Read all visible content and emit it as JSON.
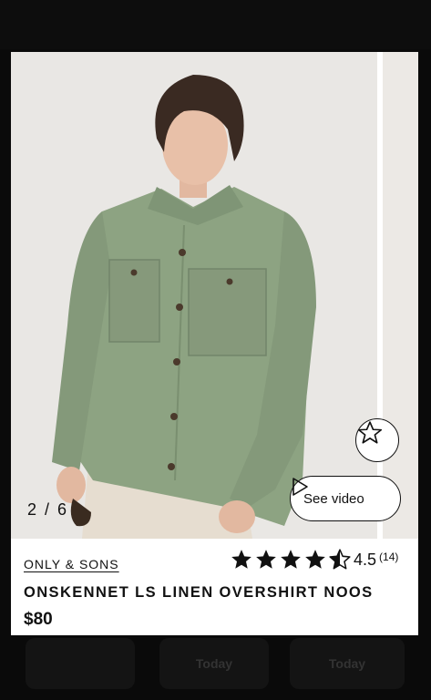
{
  "background": {
    "tiles": [
      "",
      "Today",
      "Today"
    ]
  },
  "gallery": {
    "counter": "2 / 6",
    "see_video_label": "See video"
  },
  "product": {
    "brand": "ONLY & SONS",
    "name": "ONSKENNET LS LINEN OVERSHIRT NOOS",
    "price": "$80",
    "rating_value": "4.5",
    "rating_count": "(14)",
    "rating": 4.5,
    "rating_max": 5
  },
  "colors": {
    "shirt": "#8da382",
    "backdrop": "#e9e7e4",
    "text": "#111111"
  },
  "icons": {
    "favorite": "star-outline-icon",
    "video": "play-triangle-icon",
    "rating": "star-icon"
  }
}
